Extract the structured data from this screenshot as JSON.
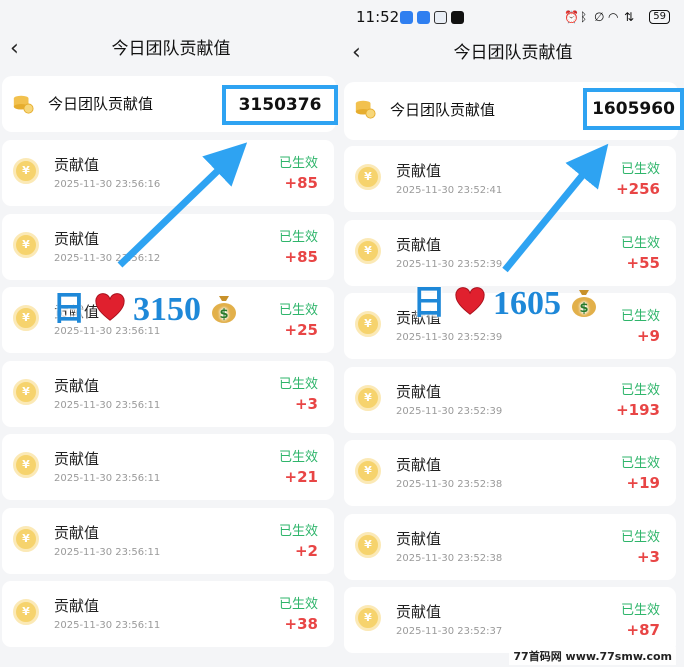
{
  "left": {
    "title": "今日团队贡献值",
    "team_label": "今日团队贡献值",
    "team_total": "3150376",
    "items": [
      {
        "title": "贡献值",
        "time": "2025-11-30 23:56:16",
        "status": "已生效",
        "amount": "+85"
      },
      {
        "title": "贡献值",
        "time": "2025-11-30 23:56:12",
        "status": "已生效",
        "amount": "+85"
      },
      {
        "title": "贡献值",
        "time": "2025-11-30 23:56:11",
        "status": "已生效",
        "amount": "+25"
      },
      {
        "title": "贡献值",
        "time": "2025-11-30 23:56:11",
        "status": "已生效",
        "amount": "+3"
      },
      {
        "title": "贡献值",
        "time": "2025-11-30 23:56:11",
        "status": "已生效",
        "amount": "+21"
      },
      {
        "title": "贡献值",
        "time": "2025-11-30 23:56:11",
        "status": "已生效",
        "amount": "+2"
      },
      {
        "title": "贡献值",
        "time": "2025-11-30 23:56:11",
        "status": "已生效",
        "amount": "+38"
      }
    ],
    "overlay_prefix": "日",
    "overlay_number": "3150"
  },
  "right": {
    "status_time": "11:52",
    "battery": "59",
    "title": "今日团队贡献值",
    "team_label": "今日团队贡献值",
    "team_total": "1605960",
    "items": [
      {
        "title": "贡献值",
        "time": "2025-11-30 23:52:41",
        "status": "已生效",
        "amount": "+256"
      },
      {
        "title": "贡献值",
        "time": "2025-11-30 23:52:39",
        "status": "已生效",
        "amount": "+55"
      },
      {
        "title": "贡献值",
        "time": "2025-11-30 23:52:39",
        "status": "已生效",
        "amount": "+9"
      },
      {
        "title": "贡献值",
        "time": "2025-11-30 23:52:39",
        "status": "已生效",
        "amount": "+193"
      },
      {
        "title": "贡献值",
        "time": "2025-11-30 23:52:38",
        "status": "已生效",
        "amount": "+19"
      },
      {
        "title": "贡献值",
        "time": "2025-11-30 23:52:38",
        "status": "已生效",
        "amount": "+3"
      },
      {
        "title": "贡献值",
        "time": "2025-11-30 23:52:37",
        "status": "已生效",
        "amount": "+87"
      }
    ],
    "overlay_prefix": "日",
    "overlay_number": "1605"
  },
  "icons": {
    "back": "chevron-left-icon",
    "team": "coin-stack-icon",
    "coin": "yuan-coin-icon",
    "coin_glyph": "¥",
    "heart": "heart-icon",
    "money_bag": "money-bag-icon",
    "arrow": "arrow-icon"
  },
  "colors": {
    "highlight_box": "#2ea3f2",
    "status_green": "#2fb56b",
    "amount_red": "#e84545",
    "overlay_blue": "#1e88d8",
    "coin_gold": "#f6d36d"
  },
  "watermark": "77首码网 www.77smw.com"
}
